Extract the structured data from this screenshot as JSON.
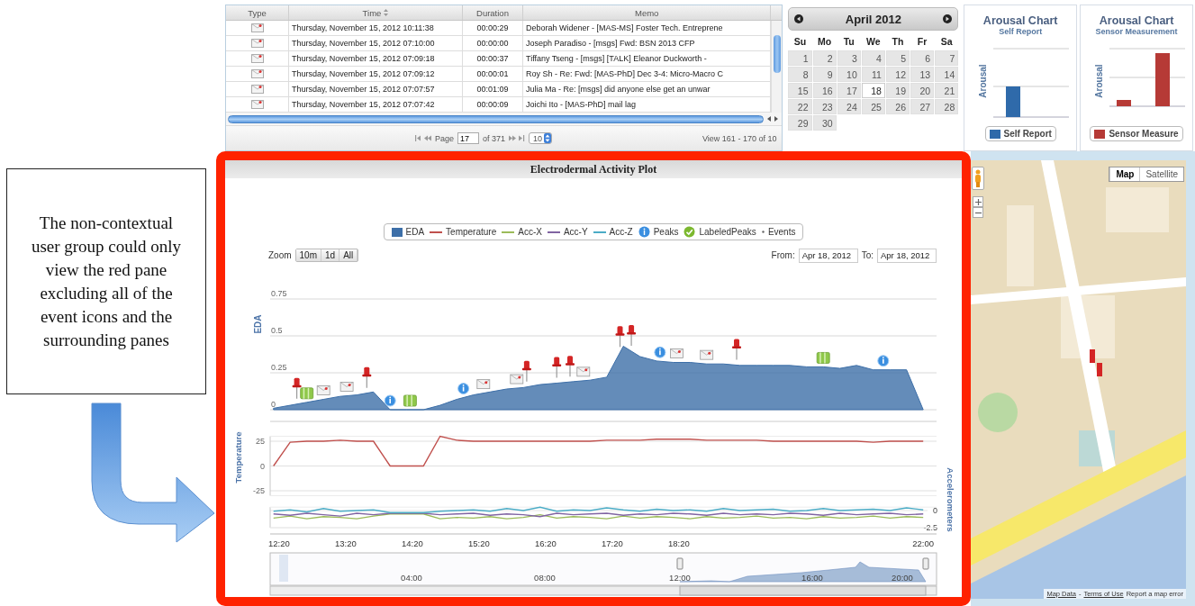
{
  "annotation": {
    "text": "The non-contextual user group could only view the red pane excluding all of the event icons and the surrounding panes"
  },
  "message_grid": {
    "columns": [
      "Type",
      "Time",
      "Duration",
      "Memo"
    ],
    "rows": [
      {
        "time": "Thursday, November 15, 2012 10:11:38",
        "duration": "00:00:29",
        "memo": "Deborah Widener - [MAS-MS] Foster Tech. Entreprene"
      },
      {
        "time": "Thursday, November 15, 2012 07:10:00",
        "duration": "00:00:00",
        "memo": "Joseph Paradiso - [msgs] Fwd: BSN 2013 CFP"
      },
      {
        "time": "Thursday, November 15, 2012 07:09:18",
        "duration": "00:00:37",
        "memo": "Tiffany Tseng - [msgs] [TALK] Eleanor Duckworth -"
      },
      {
        "time": "Thursday, November 15, 2012 07:09:12",
        "duration": "00:00:01",
        "memo": "Roy Sh - Re: Fwd: [MAS-PhD] Dec 3-4: Micro-Macro C"
      },
      {
        "time": "Thursday, November 15, 2012 07:07:57",
        "duration": "00:01:09",
        "memo": "Julia Ma - Re: [msgs] did anyone else get an unwar"
      },
      {
        "time": "Thursday, November 15, 2012 07:07:42",
        "duration": "00:00:09",
        "memo": "Joichi Ito - [MAS-PhD] mail lag"
      }
    ],
    "pager": {
      "page_label": "Page",
      "page": "17",
      "of": "of 371",
      "page_size": "10",
      "view": "View 161 - 170 of 10"
    }
  },
  "calendar": {
    "title": "April 2012",
    "weekdays": [
      "Su",
      "Mo",
      "Tu",
      "We",
      "Th",
      "Fr",
      "Sa"
    ],
    "days": [
      {
        "label": "1",
        "selected": false
      },
      {
        "label": "2",
        "selected": false
      },
      {
        "label": "3",
        "selected": false
      },
      {
        "label": "4",
        "selected": false
      },
      {
        "label": "5",
        "selected": false
      },
      {
        "label": "6",
        "selected": false
      },
      {
        "label": "7",
        "selected": false
      },
      {
        "label": "8",
        "selected": false
      },
      {
        "label": "9",
        "selected": false
      },
      {
        "label": "10",
        "selected": false
      },
      {
        "label": "11",
        "selected": false
      },
      {
        "label": "12",
        "selected": false
      },
      {
        "label": "13",
        "selected": false
      },
      {
        "label": "14",
        "selected": false
      },
      {
        "label": "15",
        "selected": false
      },
      {
        "label": "16",
        "selected": false
      },
      {
        "label": "17",
        "selected": false
      },
      {
        "label": "18",
        "selected": true
      },
      {
        "label": "19",
        "selected": false
      },
      {
        "label": "20",
        "selected": false
      },
      {
        "label": "21",
        "selected": false
      },
      {
        "label": "22",
        "selected": false
      },
      {
        "label": "23",
        "selected": false
      },
      {
        "label": "24",
        "selected": false
      },
      {
        "label": "25",
        "selected": false
      },
      {
        "label": "26",
        "selected": false
      },
      {
        "label": "27",
        "selected": false
      },
      {
        "label": "28",
        "selected": false
      },
      {
        "label": "29",
        "selected": false
      },
      {
        "label": "30",
        "selected": false
      }
    ]
  },
  "arousal_charts": [
    {
      "kind": "self",
      "title": "Arousal Chart",
      "subtitle": "Self Report",
      "ylabel": "Arousal",
      "legend": "Self Report",
      "color": "#2f6aaa"
    },
    {
      "kind": "sensor",
      "title": "Arousal Chart",
      "subtitle": "Sensor Measurement",
      "ylabel": "Arousal",
      "legend": "Sensor Measure",
      "color": "#b63a36"
    }
  ],
  "eda_plot": {
    "title": "Electrodermal Activity Plot",
    "legend": [
      {
        "kind": "area"
      },
      {
        "kind": "temperature"
      },
      {
        "kind": "acc"
      },
      {
        "kind": "acc"
      },
      {
        "kind": "acc"
      },
      {
        "label": "Peaks",
        "kind": "peak"
      },
      {
        "label": "LabeledPeaks",
        "kind": "labeled"
      },
      {
        "label": "Events",
        "kind": "event"
      }
    ],
    "zoom_label": "Zoom",
    "zoom_buttons": [
      "10m",
      "1d",
      "All"
    ],
    "from_label": "From:",
    "from": "Apr 18, 2012",
    "to_label": "To:",
    "to": "Apr 18, 2012",
    "eda_panel": {
      "chart_data": {
        "type": "area",
        "ylabel": "EDA",
        "x": [
          12.25,
          12.5,
          12.75,
          13,
          13.25,
          13.5,
          13.75,
          14,
          14.25,
          14.5,
          14.75,
          15,
          15.25,
          15.5,
          15.75,
          16,
          16.25,
          16.5,
          16.75,
          17,
          17.25,
          17.5,
          17.75,
          18,
          18.25,
          18.5,
          18.75,
          19,
          19.25,
          19.5,
          19.75,
          20,
          20.25,
          20.5,
          20.75,
          21,
          21.25,
          21.5,
          21.75,
          22
        ],
        "series": [
          {
            "name": "EDA",
            "color": "#3d6fa8",
            "values": [
              0.01,
              0.03,
              0.05,
              0.07,
              0.09,
              0.1,
              0.12,
              0,
              0,
              0,
              0.03,
              0.07,
              0.1,
              0.12,
              0.14,
              0.15,
              0.17,
              0.18,
              0.19,
              0.2,
              0.22,
              0.43,
              0.36,
              0.33,
              0.32,
              0.32,
              0.31,
              0.31,
              0.3,
              0.3,
              0.3,
              0.3,
              0.29,
              0.29,
              0.28,
              0.3,
              0.27,
              0.27,
              0.27,
              0
            ]
          }
        ],
        "xlim": [
          12.2,
          22.2
        ],
        "ylim": [
          0,
          0.75
        ],
        "yticks": [
          0.75,
          0.5,
          0.25,
          0
        ],
        "grid": true
      }
    },
    "temperature_panel": {
      "chart_data": {
        "type": "line",
        "ylabel": "Temperature",
        "x": [
          12.25,
          12.5,
          12.75,
          13,
          13.25,
          13.5,
          13.75,
          14,
          14.25,
          14.5,
          14.75,
          15,
          15.25,
          15.5,
          15.75,
          16,
          16.25,
          16.5,
          16.75,
          17,
          17.25,
          17.5,
          17.75,
          18,
          18.25,
          18.5,
          18.75,
          19,
          19.25,
          19.5,
          19.75,
          20,
          20.25,
          20.5,
          20.75,
          21,
          21.25,
          21.5,
          21.75,
          22
        ],
        "series": [
          {
            "name": "Temperature",
            "color": "#c0504d",
            "values": [
              0,
              24,
              25,
              25,
              26,
              25,
              25,
              0,
              0,
              0,
              30,
              26,
              25,
              25,
              25,
              25,
              25,
              25,
              25,
              25,
              26,
              26,
              26,
              27,
              27,
              27,
              26,
              26,
              26,
              26,
              25,
              25,
              25,
              25,
              25,
              25,
              24,
              25,
              25,
              25
            ]
          }
        ],
        "xlim": [
          12.2,
          22.2
        ],
        "ylim": [
          -30,
          30
        ],
        "yticks": [
          25,
          0,
          -25
        ],
        "grid": true
      }
    },
    "accelerometer_panel": {
      "chart_data": {
        "type": "line",
        "ylabel": "Accelerometers",
        "x": [
          12.25,
          12.5,
          12.75,
          13,
          13.25,
          13.5,
          13.75,
          14,
          14.25,
          14.5,
          14.75,
          15,
          15.25,
          15.5,
          15.75,
          16,
          16.25,
          16.5,
          16.75,
          17,
          17.25,
          17.5,
          17.75,
          18,
          18.25,
          18.5,
          18.75,
          19,
          19.25,
          19.5,
          19.75,
          20,
          20.25,
          20.5,
          20.75,
          21,
          21.25,
          21.5,
          21.75,
          22
        ],
        "series": [
          {
            "name": "Acc-X",
            "color": "#9bbb59",
            "values": [
              -1.1,
              -0.8,
              -1.2,
              -0.9,
              -1,
              -1.2,
              -0.8,
              -0.5,
              -0.5,
              -0.5,
              -1.2,
              -1,
              -1.1,
              -0.9,
              -1.2,
              -1,
              -0.6,
              -1.1,
              -0.9,
              -1,
              -1.2,
              -0.8,
              -1.1,
              -0.9,
              -1,
              -1.2,
              -0.9,
              -1.1,
              -1,
              -0.8,
              -1.1,
              -1,
              -1.2,
              -0.9,
              -1.1,
              -1,
              -0.8,
              -1.1,
              -0.9,
              -1
            ]
          },
          {
            "name": "Acc-Y",
            "color": "#8064a2",
            "values": [
              -0.5,
              -0.7,
              -0.4,
              -0.6,
              -0.8,
              -0.4,
              -0.6,
              -0.4,
              -0.4,
              -0.4,
              -0.6,
              -0.5,
              -0.4,
              -0.7,
              -0.5,
              -0.6,
              -0.9,
              -0.4,
              -0.6,
              -0.5,
              -0.4,
              -0.7,
              -0.5,
              -0.6,
              -0.4,
              -0.5,
              -0.7,
              -0.4,
              -0.6,
              -0.5,
              -0.6,
              -0.4,
              -0.5,
              -0.7,
              -0.4,
              -0.6,
              -0.5,
              -0.4,
              -0.6,
              -0.5
            ]
          },
          {
            "name": "Acc-Z",
            "color": "#4bacc6",
            "values": [
              -0.1,
              0.1,
              -0.2,
              0.3,
              -0.1,
              0,
              0.1,
              -0.3,
              -0.3,
              -0.3,
              -0.1,
              0,
              0.1,
              -0.1,
              0.3,
              0,
              0.5,
              -0.1,
              0.1,
              0,
              0.4,
              0.1,
              -0.1,
              0.2,
              0,
              0.1,
              -0.1,
              0.3,
              0,
              0.1,
              0.2,
              -0.1,
              0,
              0.3,
              0,
              0.1,
              0.2,
              0,
              0.4,
              0.1
            ]
          }
        ],
        "xlim": [
          12.2,
          22.2
        ],
        "ylim": [
          -2.5,
          0.5
        ],
        "yticks": [
          0,
          -2.5
        ],
        "grid": true,
        "xticks": [
          {
            "value": 12.333,
            "label": "12:20"
          },
          {
            "value": 13.333,
            "label": "13:20"
          },
          {
            "value": 14.333,
            "label": "14:20"
          },
          {
            "value": 15.333,
            "label": "15:20"
          },
          {
            "value": 16.333,
            "label": "16:20"
          },
          {
            "value": 17.333,
            "label": "17:20"
          },
          {
            "value": 18.333,
            "label": "18:20"
          },
          {
            "value": 22,
            "label": "22:00"
          }
        ]
      }
    },
    "navigator_ticks": [
      "04:00",
      "08:00",
      "12:00",
      "16:00",
      "20:00"
    ]
  },
  "map": {
    "kind": "picture",
    "buttons": [
      {
        "label": "Map",
        "selected": true
      },
      {
        "label": "Satellite",
        "selected": false
      }
    ],
    "footer_links": [
      "Map Data",
      "Terms of Use"
    ],
    "separator": "-",
    "report": "Report a map error"
  }
}
